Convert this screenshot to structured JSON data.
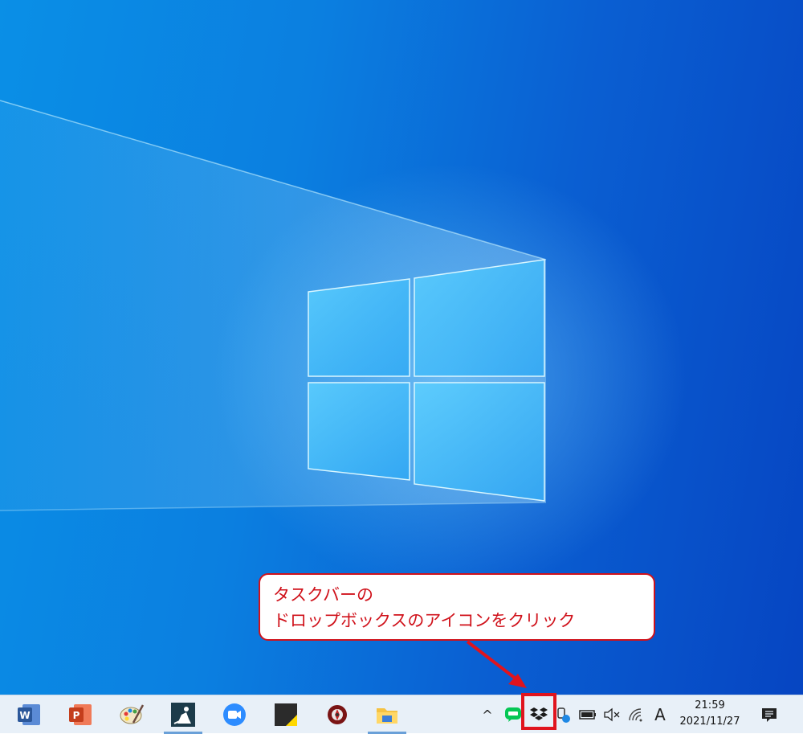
{
  "annotation": {
    "line1": "タスクバーの",
    "line2": "ドロップボックスのアイコンをクリック",
    "color": "#d0121b"
  },
  "taskbar": {
    "apps": [
      {
        "name": "word-icon"
      },
      {
        "name": "powerpoint-icon"
      },
      {
        "name": "paint-icon"
      },
      {
        "name": "kindle-icon"
      },
      {
        "name": "zoom-icon"
      },
      {
        "name": "sticky-notes-icon"
      },
      {
        "name": "app-icon"
      },
      {
        "name": "file-explorer-icon"
      }
    ],
    "tray": {
      "chevron": "^",
      "ime": "A"
    },
    "clock": {
      "time": "21:59",
      "date": "2021/11/27"
    }
  },
  "colors": {
    "desktop_blue": "#0a7fe0",
    "taskbar": "#e8f0f8",
    "dropbox": "#0061fe",
    "line_green": "#06c755"
  }
}
